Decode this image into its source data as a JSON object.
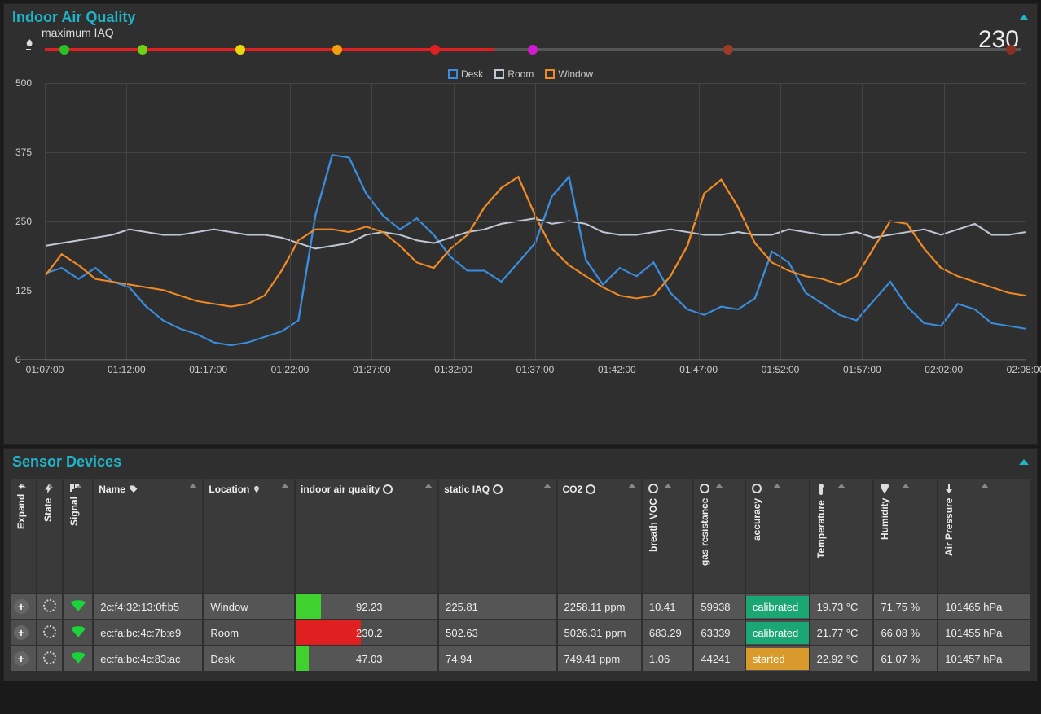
{
  "iaq_panel": {
    "title": "Indoor Air Quality",
    "gauge_label": "maximum IAQ",
    "gauge_value": "230",
    "gauge_fill_pct": 46,
    "gauge_stops": [
      {
        "pct": 2,
        "color": "#28c228"
      },
      {
        "pct": 10,
        "color": "#6ed017"
      },
      {
        "pct": 20,
        "color": "#e5d90e"
      },
      {
        "pct": 30,
        "color": "#f0a00b"
      },
      {
        "pct": 40,
        "color": "#e02020"
      },
      {
        "pct": 50,
        "color": "#d11bd1"
      },
      {
        "pct": 70,
        "color": "#9b3a2a"
      },
      {
        "pct": 99,
        "color": "#8a3020"
      }
    ]
  },
  "chart_data": {
    "type": "line",
    "title": "",
    "xlabel": "",
    "ylabel": "",
    "ylim": [
      0,
      500
    ],
    "y_ticks": [
      0,
      125,
      250,
      375,
      500
    ],
    "x_ticks": [
      "01:07:00",
      "01:12:00",
      "01:17:00",
      "01:22:00",
      "01:27:00",
      "01:32:00",
      "01:37:00",
      "01:42:00",
      "01:47:00",
      "01:52:00",
      "01:57:00",
      "02:02:00",
      "02:08:00"
    ],
    "series": [
      {
        "name": "Desk",
        "color": "#3a8dde",
        "values": [
          155,
          165,
          145,
          165,
          140,
          130,
          95,
          70,
          55,
          45,
          30,
          25,
          30,
          40,
          50,
          70,
          260,
          370,
          365,
          300,
          260,
          235,
          255,
          225,
          185,
          160,
          160,
          140,
          175,
          210,
          295,
          330,
          180,
          135,
          165,
          150,
          175,
          120,
          90,
          80,
          95,
          90,
          110,
          195,
          175,
          120,
          100,
          80,
          70,
          105,
          140,
          95,
          65,
          60,
          100,
          90,
          65,
          60,
          55
        ]
      },
      {
        "name": "Room",
        "color": "#bfc7d5",
        "values": [
          205,
          210,
          215,
          220,
          225,
          235,
          230,
          225,
          225,
          230,
          235,
          230,
          225,
          225,
          220,
          210,
          200,
          205,
          210,
          225,
          230,
          225,
          215,
          210,
          220,
          230,
          235,
          245,
          250,
          255,
          245,
          250,
          245,
          230,
          225,
          225,
          230,
          235,
          230,
          225,
          225,
          230,
          225,
          225,
          235,
          230,
          225,
          225,
          230,
          220,
          225,
          230,
          235,
          225,
          235,
          245,
          225,
          225,
          230
        ]
      },
      {
        "name": "Window",
        "color": "#f08a24",
        "values": [
          150,
          190,
          170,
          145,
          140,
          135,
          130,
          125,
          115,
          105,
          100,
          95,
          100,
          115,
          160,
          215,
          235,
          235,
          230,
          240,
          230,
          205,
          175,
          165,
          200,
          225,
          275,
          310,
          330,
          260,
          200,
          170,
          150,
          130,
          115,
          110,
          115,
          150,
          205,
          300,
          325,
          275,
          210,
          175,
          160,
          150,
          145,
          135,
          150,
          200,
          250,
          245,
          200,
          165,
          150,
          140,
          130,
          120,
          115
        ]
      }
    ],
    "legend_position": "top"
  },
  "devices_panel": {
    "title": "Sensor Devices",
    "columns": {
      "expand": "Expand",
      "state": "State",
      "signal": "Signal",
      "name": "Name",
      "location": "Location",
      "iaq": "indoor air quality",
      "siaq": "static IAQ",
      "co2": "CO2",
      "bvoc": "breath VOC",
      "gas": "gas resistance",
      "accuracy": "accuracy",
      "temp": "Temperature",
      "humidity": "Humidity",
      "pressure": "Air Pressure"
    },
    "rows": [
      {
        "name": "2c:f4:32:13:0f:b5",
        "location": "Window",
        "iaq": "92.23",
        "iaq_bar_pct": 18,
        "iaq_bar_color": "#3fd12e",
        "siaq": "225.81",
        "co2": "2258.11 ppm",
        "bvoc": "10.41",
        "gas": "59938",
        "accuracy": "calibrated",
        "acc_color": "#1aa774",
        "temp": "19.73 °C",
        "humidity": "71.75 %",
        "pressure": "101465 hPa"
      },
      {
        "name": "ec:fa:bc:4c:7b:e9",
        "location": "Room",
        "iaq": "230.2",
        "iaq_bar_pct": 46,
        "iaq_bar_color": "#e02020",
        "siaq": "502.63",
        "co2": "5026.31 ppm",
        "bvoc": "683.29",
        "gas": "63339",
        "accuracy": "calibrated",
        "acc_color": "#1aa774",
        "temp": "21.77 °C",
        "humidity": "66.08 %",
        "pressure": "101455 hPa"
      },
      {
        "name": "ec:fa:bc:4c:83:ac",
        "location": "Desk",
        "iaq": "47.03",
        "iaq_bar_pct": 9,
        "iaq_bar_color": "#3fd12e",
        "siaq": "74.94",
        "co2": "749.41 ppm",
        "bvoc": "1.06",
        "gas": "44241",
        "accuracy": "started",
        "acc_color": "#d89a2b",
        "temp": "22.92 °C",
        "humidity": "61.07 %",
        "pressure": "101457 hPa"
      }
    ]
  }
}
